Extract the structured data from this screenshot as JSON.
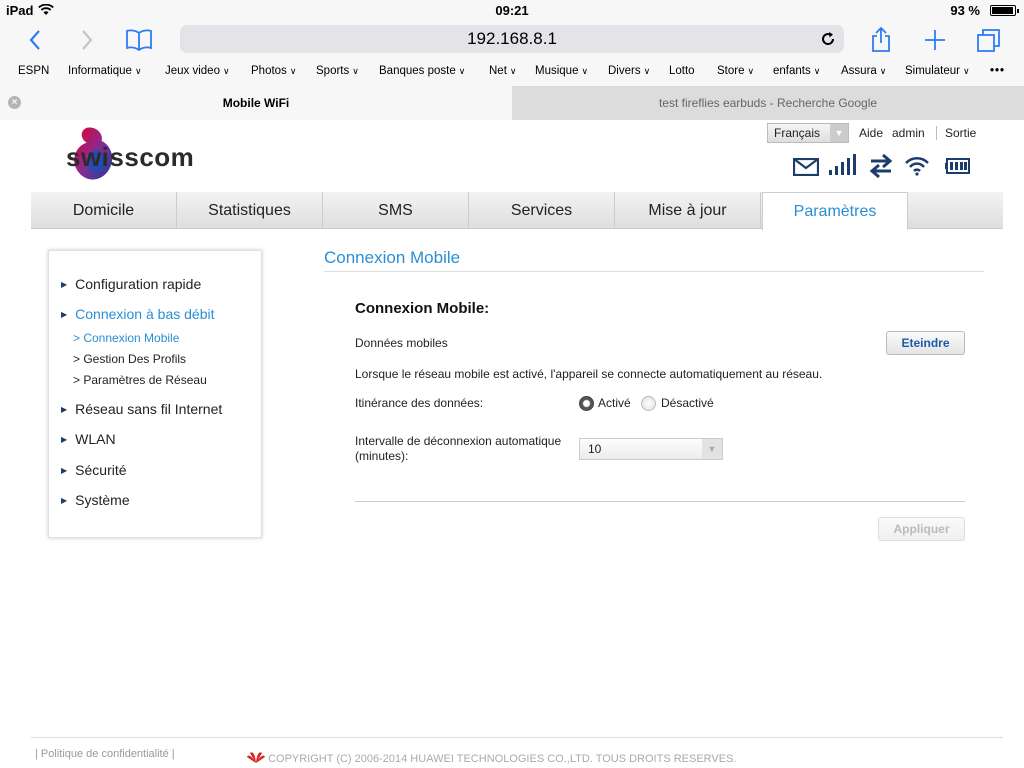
{
  "status_bar": {
    "device": "iPad",
    "time": "09:21",
    "battery": "93 %"
  },
  "browser": {
    "url": "192.168.8.1",
    "bookmarks": [
      {
        "label": "ESPN",
        "menu": false
      },
      {
        "label": "Informatique",
        "menu": true
      },
      {
        "label": "Jeux video",
        "menu": true
      },
      {
        "label": "Photos",
        "menu": true
      },
      {
        "label": "Sports",
        "menu": true
      },
      {
        "label": "Banques poste",
        "menu": true
      },
      {
        "label": "Net",
        "menu": true
      },
      {
        "label": "Musique",
        "menu": true
      },
      {
        "label": "Divers",
        "menu": true
      },
      {
        "label": "Lotto",
        "menu": false
      },
      {
        "label": "Store",
        "menu": true
      },
      {
        "label": "enfants",
        "menu": true
      },
      {
        "label": "Assura",
        "menu": true
      },
      {
        "label": "Simulateur",
        "menu": true
      }
    ],
    "tabs": [
      {
        "label": "Mobile WiFi",
        "active": true
      },
      {
        "label": "test fireflies earbuds - Recherche Google",
        "active": false
      }
    ]
  },
  "header": {
    "brand": "swisscom",
    "language": "Français",
    "links": {
      "help": "Aide",
      "user": "admin",
      "logout": "Sortie"
    }
  },
  "nav": {
    "items": [
      "Domicile",
      "Statistiques",
      "SMS",
      "Services",
      "Mise à jour",
      "Paramètres"
    ],
    "active": "Paramètres"
  },
  "sidebar": {
    "config_rapide": "Configuration rapide",
    "bas_debit": "Connexion à bas débit",
    "sub_connexion_mobile": "> Connexion Mobile",
    "sub_gestion_profils": "> Gestion Des Profils",
    "sub_parametres_reseau": "> Paramètres de Réseau",
    "reseau_sans_fil": "Réseau sans fil Internet",
    "wlan": "WLAN",
    "securite": "Sécurité",
    "systeme": "Système"
  },
  "content": {
    "page_title": "Connexion Mobile",
    "section_title": "Connexion Mobile:",
    "mobile_data_label": "Données mobiles",
    "mobile_data_button": "Eteindre",
    "info_text": "Lorsque le réseau mobile est activé, l'appareil se connecte automatiquement au réseau.",
    "roaming_label": "Itinérance des données:",
    "roaming_on": "Activé",
    "roaming_off": "Désactivé",
    "roaming_value": "Activé",
    "interval_label_1": "Intervalle de déconnexion automatique",
    "interval_label_2": "(minutes):",
    "interval_value": "10",
    "apply_button": "Appliquer"
  },
  "footer": {
    "privacy": "Politique de confidentialité",
    "copyright": "COPYRIGHT (C) 2006-2014 HUAWEI TECHNOLOGIES CO.,LTD. TOUS DROITS RESERVES."
  },
  "colors": {
    "accent": "#2a8fd4",
    "ios_blue": "#2d7bf5",
    "swisscom_red": "#e4002b"
  }
}
